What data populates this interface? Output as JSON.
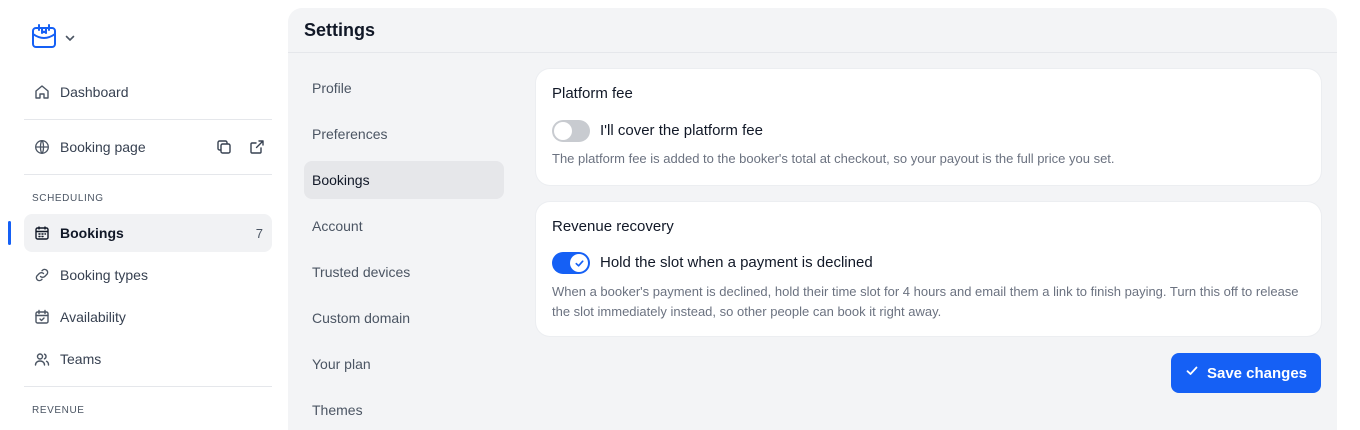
{
  "sidebar": {
    "nav": {
      "dashboard": "Dashboard",
      "booking_page": "Booking page",
      "bookings": "Bookings",
      "bookings_count": "7",
      "booking_types": "Booking types",
      "availability": "Availability",
      "teams": "Teams"
    },
    "sections": {
      "scheduling": "SCHEDULING",
      "revenue": "REVENUE"
    }
  },
  "settings": {
    "title": "Settings",
    "menu": [
      "Profile",
      "Preferences",
      "Bookings",
      "Account",
      "Trusted devices",
      "Custom domain",
      "Your plan",
      "Themes"
    ],
    "active_menu": "Bookings",
    "platform_fee": {
      "title": "Platform fee",
      "toggle_label": "I'll cover the platform fee",
      "toggle_on": false,
      "help": "The platform fee is added to the booker's total at checkout, so your payout is the full price you set."
    },
    "revenue_recovery": {
      "title": "Revenue recovery",
      "toggle_label": "Hold the slot when a payment is declined",
      "toggle_on": true,
      "help": "When a booker's payment is declined, hold their time slot for 4 hours and email them a link to finish paying. Turn this off to release the slot immediately instead, so other people can book it right away."
    },
    "save_label": "Save changes"
  },
  "colors": {
    "accent": "#1560f5",
    "panel_bg": "#f3f4f6",
    "toggle_off": "#c8cbd0"
  }
}
